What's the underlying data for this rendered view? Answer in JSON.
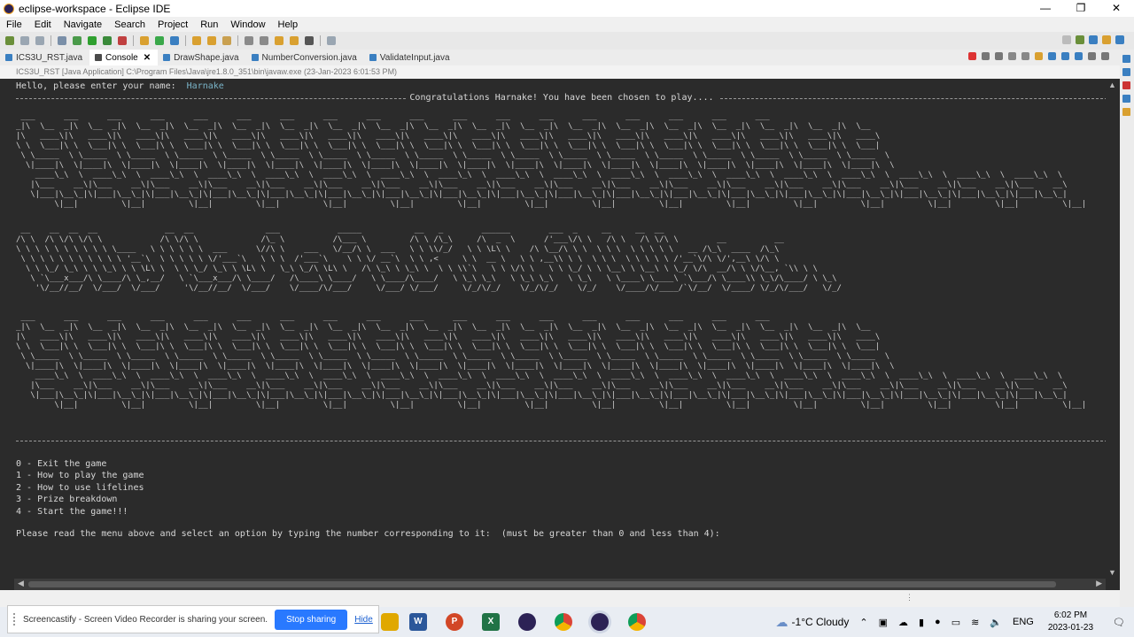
{
  "window": {
    "title": "eclipse-workspace - Eclipse IDE",
    "controls": [
      "—",
      "❐",
      "✕"
    ]
  },
  "menubar": [
    "File",
    "Edit",
    "Navigate",
    "Search",
    "Project",
    "Run",
    "Window",
    "Help"
  ],
  "tabs": [
    {
      "label": "ICS3U_RST.java",
      "active": false
    },
    {
      "label": "Console",
      "active": true
    },
    {
      "label": "DrawShape.java",
      "active": false
    },
    {
      "label": "NumberConversion.java",
      "active": false
    },
    {
      "label": "ValidateInput.java",
      "active": false
    }
  ],
  "tab_close_glyph": "✕",
  "status_line": "ICS3U_RST [Java Application] C:\\Program Files\\Java\\jre1.8.0_351\\bin\\javaw.exe  (23-Jan-2023 6:01:53 PM)",
  "console": {
    "prompt": "Hello, please enter your name:  ",
    "user_input": "Harnake",
    "congrats": "Congratulations Harnake! You have been chosen to play....",
    "banner_top": " ___      ___      ___      ___      ___      ___      ___      ___      ___      ___      ___      ___      ___      ___      ___      ___      ___      ___\n_|\\  \\__  _|\\  \\__  _|\\  \\__  _|\\  \\__  _|\\  \\__  _|\\  \\__  _|\\  \\__  _|\\  \\__  _|\\  \\__  _|\\  \\__  _|\\  \\__  _|\\  \\__  _|\\  \\__  _|\\  \\__  _|\\  \\__  _|\\  \\__  _|\\  \\__  _|\\  \\__\n|\\   ____\\|\\   ____\\|\\   ____\\|\\   ____\\|\\   ____\\|\\   ____\\|\\   ____\\|\\   ____\\|\\   ____\\|\\   ____\\|\\   ____\\|\\   ____\\|\\   ____\\|\\   ____\\|\\   ____\\|\\   ____\\|\\   ____\\|\\   ____\\\n\\ \\  \\___|\\ \\  \\___|\\ \\  \\___|\\ \\  \\___|\\ \\  \\___|\\ \\  \\___|\\ \\  \\___|\\ \\  \\___|\\ \\  \\___|\\ \\  \\___|\\ \\  \\___|\\ \\  \\___|\\ \\  \\___|\\ \\  \\___|\\ \\  \\___|\\ \\  \\___|\\ \\  \\___|\\ \\  \\___|\n \\ \\_____  \\ \\_____  \\ \\_____  \\ \\_____  \\ \\_____  \\ \\_____  \\ \\_____  \\ \\_____  \\ \\_____  \\ \\_____  \\ \\_____  \\ \\_____  \\ \\_____  \\ \\_____  \\ \\_____  \\ \\_____  \\ \\_____  \\ \\_____  \\\n  \\|____|\\  \\|____|\\  \\|____|\\  \\|____|\\  \\|____|\\  \\|____|\\  \\|____|\\  \\|____|\\  \\|____|\\  \\|____|\\  \\|____|\\  \\|____|\\  \\|____|\\  \\|____|\\  \\|____|\\  \\|____|\\  \\|____|\\  \\|____|\\  \\\n    ____\\_\\  \\  ____\\_\\  \\  ____\\_\\  \\  ____\\_\\  \\  ____\\_\\  \\  ____\\_\\  \\  ____\\_\\  \\  ____\\_\\  \\  ____\\_\\  \\  ____\\_\\  \\  ____\\_\\  \\  ____\\_\\  \\  ____\\_\\  \\  ____\\_\\  \\  ____\\_\\  \\  ____\\_\\  \\  ____\\_\\  \\  ____\\_\\  \\\n   |\\___    __\\|\\___    __\\|\\___    __\\|\\___    __\\|\\___    __\\|\\___    __\\|\\___    __\\|\\___    __\\|\\___    __\\|\\___    __\\|\\___    __\\|\\___    __\\|\\___    __\\|\\___    __\\|\\___    __\\|\\___    __\\|\\___    __\\|\\___    __\\\n   \\|___|\\__\\_|\\|___|\\__\\_|\\|___|\\__\\_|\\|___|\\__\\_|\\|___|\\__\\_|\\|___|\\__\\_|\\|___|\\__\\_|\\|___|\\__\\_|\\|___|\\__\\_|\\|___|\\__\\_|\\|___|\\__\\_|\\|___|\\__\\_|\\|___|\\__\\_|\\|___|\\__\\_|\\|___|\\__\\_|\\|___|\\__\\_|\\|___|\\__\\_|\\|___|\\__\\_|\n        \\|__|         \\|__|         \\|__|         \\|__|         \\|__|         \\|__|         \\|__|         \\|__|         \\|__|         \\|__|         \\|__|         \\|__|         \\|__|         \\|__|         \\|__|         \\|__|",
    "banner_title": " __    __  __  __              __  __               ___            _____           __   _        ______        ___  _     __     __  __                          \n/\\ \\  /\\ \\/\\ \\/\\ \\            /\\ \\/\\ \\             /\\_ \\          /\\___ \\         /\\ \\ /\\_\\     /\\  _  \\      /'___\\/\\ \\   /\\ \\   /\\ \\/\\ \\        __          __    \n\\ \\ \\ \\ \\ \\ \\ \\ \\ \\ \\____   \\ \\ \\ \\ \\ \\  ___      \\//\\ \\    ___   \\/__/\\ \\  ___   \\ \\ \\\\/_/   \\ \\ \\L\\ \\    /\\ \\__/\\ \\ \\  \\ \\ \\  \\ \\ \\ \\ \\   __ /\\_\\  ____  /\\_\\   \n \\ \\ \\ \\ \\ \\ \\ \\ \\ \\ \\ '__`\\  \\ \\ \\ \\ \\ \\/'___`\\   \\ \\ \\  /'___`\\    \\ \\ \\/ __`\\  \\ \\ ,<     \\ \\  __ \\   \\ \\ ,__\\\\ \\ \\  \\ \\ \\  \\ \\ \\ \\ \\ /'__`\\/\\ \\/',__\\ \\/\\ \\  \n  \\ \\ \\_/ \\_\\ \\ \\ \\_\\ \\ \\ \\L\\ \\  \\ \\ \\_/ \\_\\ \\ \\L\\ \\   \\_\\ \\_/\\ \\L\\ \\   /\\ \\_\\ \\ \\_\\ \\  \\ \\ \\\\`\\   \\ \\ \\/\\ \\   \\ \\ \\_/ \\ \\ \\__\\ \\ \\__\\ \\ \\_/ \\/\\  __/\\ \\ \\/\\__, `\\\\ \\ \\ \n   \\ `\\___x___/\\ \\____/\\ \\_,__/   \\ `\\___x___/\\ \\____/   /\\____\\ \\____/   \\ \\____/\\____/   \\ \\_\\ \\_\\   \\ \\_\\ \\_\\   \\ \\_\\   \\ \\____\\ \\____\\ `\\___/\\ \\____\\\\ \\_\\/\\____/ \\ \\_\\\n    '\\/__//__/  \\/___/  \\/___/     '\\/__//__/  \\/___/    \\/____/\\/___/     \\/___/ \\/___/     \\/_/\\/_/    \\/_/\\/_/    \\/_/    \\/____/\\/____/`\\/__/  \\/____/ \\/_/\\/___/   \\/_/",
    "banner_bottom": " ___      ___      ___      ___      ___      ___      ___      ___      ___      ___      ___      ___      ___      ___      ___      ___      ___      ___\n_|\\  \\__  _|\\  \\__  _|\\  \\__  _|\\  \\__  _|\\  \\__  _|\\  \\__  _|\\  \\__  _|\\  \\__  _|\\  \\__  _|\\  \\__  _|\\  \\__  _|\\  \\__  _|\\  \\__  _|\\  \\__  _|\\  \\__  _|\\  \\__  _|\\  \\__  _|\\  \\__\n|\\   ____\\|\\   ____\\|\\   ____\\|\\   ____\\|\\   ____\\|\\   ____\\|\\   ____\\|\\   ____\\|\\   ____\\|\\   ____\\|\\   ____\\|\\   ____\\|\\   ____\\|\\   ____\\|\\   ____\\|\\   ____\\|\\   ____\\|\\   ____\\\n\\ \\  \\___|\\ \\  \\___|\\ \\  \\___|\\ \\  \\___|\\ \\  \\___|\\ \\  \\___|\\ \\  \\___|\\ \\  \\___|\\ \\  \\___|\\ \\  \\___|\\ \\  \\___|\\ \\  \\___|\\ \\  \\___|\\ \\  \\___|\\ \\  \\___|\\ \\  \\___|\\ \\  \\___|\\ \\  \\___|\n \\ \\_____  \\ \\_____  \\ \\_____  \\ \\_____  \\ \\_____  \\ \\_____  \\ \\_____  \\ \\_____  \\ \\_____  \\ \\_____  \\ \\_____  \\ \\_____  \\ \\_____  \\ \\_____  \\ \\_____  \\ \\_____  \\ \\_____  \\ \\_____  \\\n  \\|____|\\  \\|____|\\  \\|____|\\  \\|____|\\  \\|____|\\  \\|____|\\  \\|____|\\  \\|____|\\  \\|____|\\  \\|____|\\  \\|____|\\  \\|____|\\  \\|____|\\  \\|____|\\  \\|____|\\  \\|____|\\  \\|____|\\  \\|____|\\  \\\n    ____\\_\\  \\  ____\\_\\  \\  ____\\_\\  \\  ____\\_\\  \\  ____\\_\\  \\  ____\\_\\  \\  ____\\_\\  \\  ____\\_\\  \\  ____\\_\\  \\  ____\\_\\  \\  ____\\_\\  \\  ____\\_\\  \\  ____\\_\\  \\  ____\\_\\  \\  ____\\_\\  \\  ____\\_\\  \\  ____\\_\\  \\  ____\\_\\  \\\n   |\\___    __\\|\\___    __\\|\\___    __\\|\\___    __\\|\\___    __\\|\\___    __\\|\\___    __\\|\\___    __\\|\\___    __\\|\\___    __\\|\\___    __\\|\\___    __\\|\\___    __\\|\\___    __\\|\\___    __\\|\\___    __\\|\\___    __\\|\\___    __\\\n   \\|___|\\__\\_|\\|___|\\__\\_|\\|___|\\__\\_|\\|___|\\__\\_|\\|___|\\__\\_|\\|___|\\__\\_|\\|___|\\__\\_|\\|___|\\__\\_|\\|___|\\__\\_|\\|___|\\__\\_|\\|___|\\__\\_|\\|___|\\__\\_|\\|___|\\__\\_|\\|___|\\__\\_|\\|___|\\__\\_|\\|___|\\__\\_|\\|___|\\__\\_|\\|___|\\__\\_|\n        \\|__|         \\|__|         \\|__|         \\|__|         \\|__|         \\|__|         \\|__|         \\|__|         \\|__|         \\|__|         \\|__|         \\|__|         \\|__|         \\|__|         \\|__|         \\|__|",
    "menu": [
      "0 - Exit the game",
      "1 - How to play the game",
      "2 - How to use lifelines",
      "3 - Prize breakdown",
      "4 - Start the game!!!"
    ],
    "question": "Please read the menu above and select an option by typing the number corresponding to it:  (must be greater than 0 and less than 4):"
  },
  "notification": {
    "text": "Screencastify - Screen Video Recorder is sharing your screen.",
    "stop_label": "Stop sharing",
    "hide_label": "Hide"
  },
  "taskbar": {
    "apps": [
      {
        "name": "word",
        "label": "W",
        "color": "#2b579a"
      },
      {
        "name": "powerpoint",
        "label": "P",
        "color": "#d24726"
      },
      {
        "name": "excel",
        "label": "X",
        "color": "#217346"
      },
      {
        "name": "eclipse",
        "label": "",
        "color": "#2c2255"
      },
      {
        "name": "chrome",
        "label": "",
        "color": "#db4437"
      },
      {
        "name": "eclipse-2",
        "label": "",
        "color": "#2c2255"
      },
      {
        "name": "chrome-2",
        "label": "",
        "color": "#db4437"
      }
    ],
    "weather": "-1°C  Cloudy",
    "language": "ENG",
    "time": "6:02 PM",
    "date": "2023-01-23"
  }
}
